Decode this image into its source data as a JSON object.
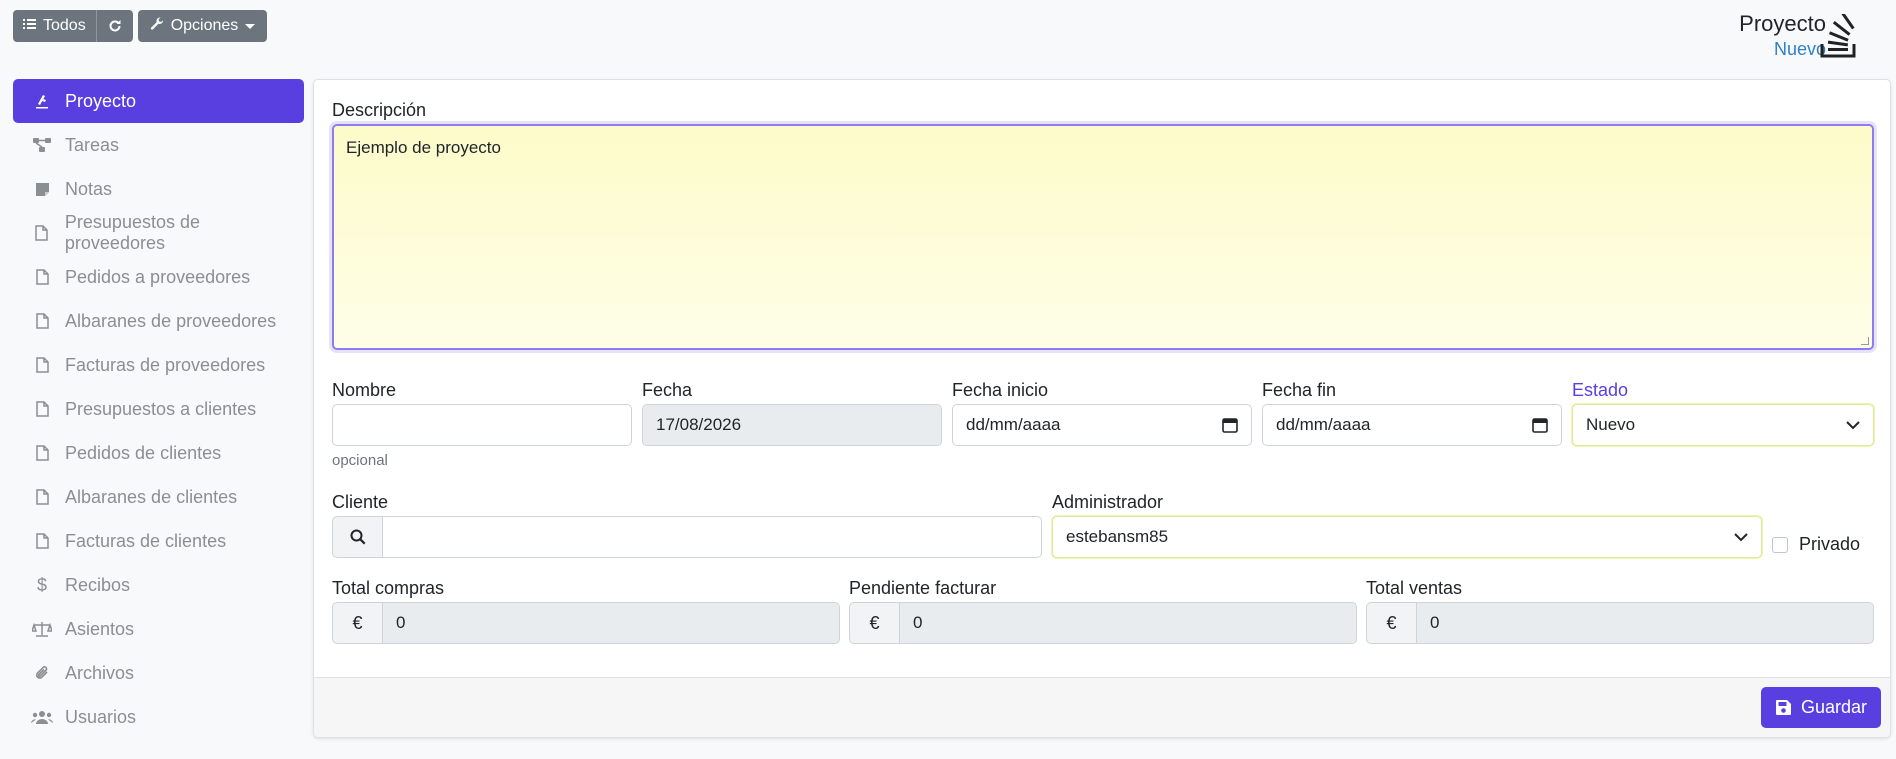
{
  "toolbar": {
    "todos_label": "Todos",
    "opciones_label": "Opciones"
  },
  "header": {
    "title": "Proyecto",
    "subtitle": "Nuevo"
  },
  "sidebar": {
    "items": [
      {
        "label": "Proyecto",
        "icon": "project-icon"
      },
      {
        "label": "Tareas",
        "icon": "tasks-icon"
      },
      {
        "label": "Notas",
        "icon": "note-icon"
      },
      {
        "label": "Presupuestos de proveedores",
        "icon": "file-icon"
      },
      {
        "label": "Pedidos a proveedores",
        "icon": "file-icon"
      },
      {
        "label": "Albaranes de proveedores",
        "icon": "file-icon"
      },
      {
        "label": "Facturas de proveedores",
        "icon": "file-icon"
      },
      {
        "label": "Presupuestos a clientes",
        "icon": "file-icon"
      },
      {
        "label": "Pedidos de clientes",
        "icon": "file-icon"
      },
      {
        "label": "Albaranes de clientes",
        "icon": "file-icon"
      },
      {
        "label": "Facturas de clientes",
        "icon": "file-icon"
      },
      {
        "label": "Recibos",
        "icon": "dollar-icon"
      },
      {
        "label": "Asientos",
        "icon": "balance-icon"
      },
      {
        "label": "Archivos",
        "icon": "paperclip-icon"
      },
      {
        "label": "Usuarios",
        "icon": "users-icon"
      }
    ]
  },
  "form": {
    "descripcion_label": "Descripción",
    "descripcion_value": "Ejemplo de proyecto",
    "nombre_label": "Nombre",
    "nombre_value": "",
    "nombre_help": "opcional",
    "fecha_label": "Fecha",
    "fecha_value": "17/08/2026",
    "fecha_inicio_label": "Fecha inicio",
    "fecha_inicio_value": "dd/mm/aaaa",
    "fecha_fin_label": "Fecha fin",
    "fecha_fin_value": "dd/mm/aaaa",
    "estado_label": "Estado",
    "estado_value": "Nuevo",
    "cliente_label": "Cliente",
    "cliente_value": "",
    "administrador_label": "Administrador",
    "administrador_value": "estebansm85",
    "privado_label": "Privado",
    "total_compras_label": "Total compras",
    "total_compras_value": "0",
    "pendiente_facturar_label": "Pendiente facturar",
    "pendiente_facturar_value": "0",
    "total_ventas_label": "Total ventas",
    "total_ventas_value": "0",
    "currency_symbol": "€"
  },
  "footer": {
    "save_label": "Guardar"
  },
  "colors": {
    "accent": "#5a3fe0",
    "subtitle": "#2f80c4",
    "secondary_button": "#6c757d"
  }
}
